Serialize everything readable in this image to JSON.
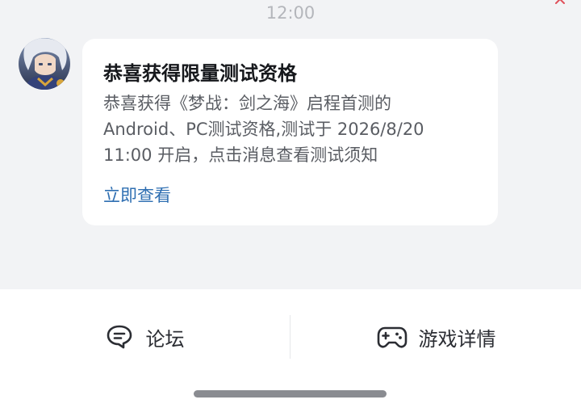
{
  "status": {
    "time": "12:00"
  },
  "message": {
    "avatar_icon": "game-character-avatar-icon",
    "title": "恭喜获得限量测试资格",
    "body_lines": [
      "恭喜获得《梦战：剑之海》启程首测的",
      "Android、PC测试资格,测试于 2026/8/20",
      "11:00 开启，点击消息查看测试须知"
    ],
    "link": "立即查看"
  },
  "bottom_bar": {
    "forum": {
      "label": "论坛",
      "icon": "forum-chat-bubble-icon"
    },
    "game_details": {
      "label": "游戏详情",
      "icon": "gamepad-icon"
    }
  },
  "colors": {
    "chat_background": "#f2f3f5",
    "bubble_background": "#ffffff",
    "link": "#2f6fb2",
    "title": "#16181c",
    "body_text": "#5a5d63",
    "time_text": "#b4b6bb"
  }
}
